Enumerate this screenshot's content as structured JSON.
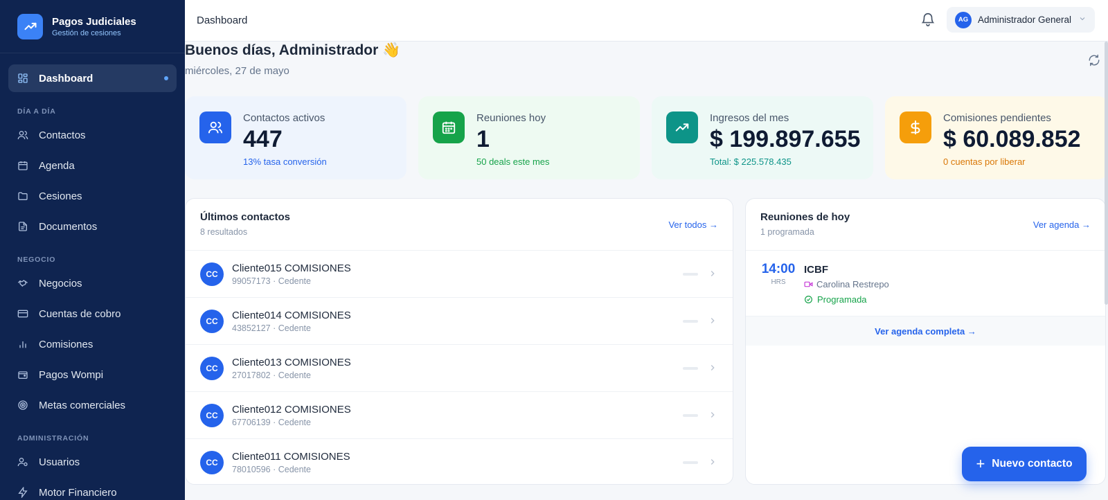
{
  "brand": {
    "title": "Pagos Judiciales",
    "subtitle": "Gestión de cesiones"
  },
  "sidebar": {
    "active": {
      "label": "Dashboard",
      "icon": "dashboard-icon"
    },
    "sections": [
      {
        "title": "DÍA A DÍA",
        "items": [
          {
            "label": "Contactos",
            "icon": "users-icon"
          },
          {
            "label": "Agenda",
            "icon": "calendar-icon"
          },
          {
            "label": "Cesiones",
            "icon": "folder-icon"
          },
          {
            "label": "Documentos",
            "icon": "document-icon"
          }
        ]
      },
      {
        "title": "NEGOCIO",
        "items": [
          {
            "label": "Negocios",
            "icon": "handshake-icon"
          },
          {
            "label": "Cuentas de cobro",
            "icon": "card-icon"
          },
          {
            "label": "Comisiones",
            "icon": "bar-chart-icon"
          },
          {
            "label": "Pagos Wompi",
            "icon": "wallet-icon"
          },
          {
            "label": "Metas comerciales",
            "icon": "target-icon"
          }
        ]
      },
      {
        "title": "ADMINISTRACIÓN",
        "items": [
          {
            "label": "Usuarios",
            "icon": "user-gear-icon"
          },
          {
            "label": "Motor Financiero",
            "icon": "bolt-icon"
          }
        ]
      }
    ]
  },
  "header": {
    "title": "Dashboard",
    "user_initials": "AG",
    "user_name": "Administrador General"
  },
  "greeting": {
    "title": "Buenos días, Administrador 👋",
    "date": "miércoles, 27 de mayo"
  },
  "stats": [
    {
      "label": "Contactos activos",
      "value": "447",
      "sub": "13% tasa conversión",
      "icon": "users-icon",
      "bg": "#eef4fd",
      "icon_bg": "#2563eb",
      "sub_color": "#2563eb"
    },
    {
      "label": "Reuniones hoy",
      "value": "1",
      "sub": "50 deals este mes",
      "icon": "calendar-icon",
      "bg": "#eefaf2",
      "icon_bg": "#16a34a",
      "sub_color": "#16a34a"
    },
    {
      "label": "Ingresos del mes",
      "value": "$ 199.897.655",
      "sub": "Total: $ 225.578.435",
      "icon": "trending-up-icon",
      "bg": "#edf9f6",
      "icon_bg": "#0d9488",
      "sub_color": "#0d9488"
    },
    {
      "label": "Comisiones pendientes",
      "value": "$ 60.089.852",
      "sub": "0 cuentas por liberar",
      "icon": "dollar-icon",
      "bg": "#fef9e8",
      "icon_bg": "#f59e0b",
      "sub_color": "#d97706"
    }
  ],
  "contacts": {
    "title": "Últimos contactos",
    "count": "8 resultados",
    "link": "Ver todos →",
    "rows": [
      {
        "initials": "CC",
        "name": "Cliente015 COMISIONES",
        "meta": "99057173 · Cedente"
      },
      {
        "initials": "CC",
        "name": "Cliente014 COMISIONES",
        "meta": "43852127 · Cedente"
      },
      {
        "initials": "CC",
        "name": "Cliente013 COMISIONES",
        "meta": "27017802 · Cedente"
      },
      {
        "initials": "CC",
        "name": "Cliente012 COMISIONES",
        "meta": "67706139 · Cedente"
      },
      {
        "initials": "CC",
        "name": "Cliente011 COMISIONES",
        "meta": "78010596 · Cedente"
      }
    ]
  },
  "meetings": {
    "title": "Reuniones de hoy",
    "count": "1 programada",
    "link": "Ver agenda →",
    "items": [
      {
        "time": "14:00",
        "unit": "HRS",
        "title": "ICBF",
        "person": "Carolina Restrepo",
        "status": "Programada"
      }
    ],
    "footer": "Ver agenda completa →"
  },
  "fab": {
    "label": "Nuevo contacto"
  }
}
